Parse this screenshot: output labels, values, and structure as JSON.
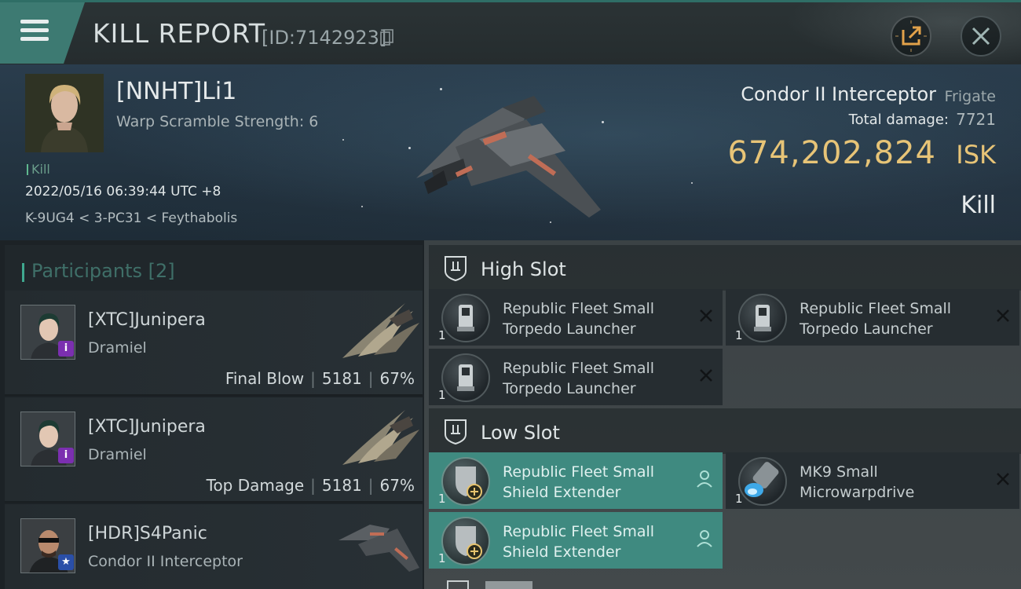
{
  "header": {
    "title": "KILL REPORT",
    "report_id": "[ID:7142923]",
    "menu_icon": "hamburger-menu-icon",
    "share_icon": "share-icon",
    "close_icon": "close-icon"
  },
  "victim": {
    "name": "[NNHT]Li1",
    "warp_scramble": "Warp Scramble Strength: 6",
    "tag": "Kill",
    "date": "2022/05/16 06:39:44 UTC +8",
    "location": "K-9UG4 < 3-PC31 < Feythabolis",
    "ship_name": "Condor II Interceptor",
    "ship_class": "Frigate",
    "total_damage_label": "Total damage:",
    "total_damage_value": "7721",
    "isk_value": "674,202,824",
    "isk_label": "ISK",
    "result": "Kill"
  },
  "participants": {
    "title": "Participants [2]",
    "items": [
      {
        "name": "[XTC]Junipera",
        "ship": "Dramiel",
        "role": "Final Blow",
        "damage": "5181",
        "percent": "67%",
        "badge": "i",
        "badge_color": "#7b2fb0"
      },
      {
        "name": "[XTC]Junipera",
        "ship": "Dramiel",
        "role": "Top Damage",
        "damage": "5181",
        "percent": "67%",
        "badge": "i",
        "badge_color": "#7b2fb0"
      },
      {
        "name": "[HDR]S4Panic",
        "ship": "Condor II Interceptor",
        "badge": "★",
        "badge_color": "#2a4fa8"
      }
    ]
  },
  "fitting": {
    "high_slot": {
      "title": "High Slot",
      "modules": [
        {
          "qty": "1",
          "line1": "Republic Fleet Small",
          "line2": "Torpedo Launcher",
          "status": "destroyed"
        },
        {
          "qty": "1",
          "line1": "Republic Fleet Small",
          "line2": "Torpedo Launcher",
          "status": "destroyed"
        },
        {
          "qty": "1",
          "line1": "Republic Fleet Small",
          "line2": "Torpedo Launcher",
          "status": "destroyed"
        }
      ]
    },
    "low_slot": {
      "title": "Low Slot",
      "modules": [
        {
          "qty": "1",
          "line1": "Republic Fleet Small",
          "line2": "Shield Extender",
          "status": "dropped"
        },
        {
          "qty": "1",
          "line1": "MK9 Small",
          "line2": "Microwarpdrive",
          "status": "destroyed"
        },
        {
          "qty": "1",
          "line1": "Republic Fleet Small",
          "line2": "Shield Extender",
          "status": "dropped"
        }
      ]
    }
  },
  "colors": {
    "accent": "#3f8a80",
    "isk_gold": "#e7c477",
    "panel": "#262d31"
  }
}
